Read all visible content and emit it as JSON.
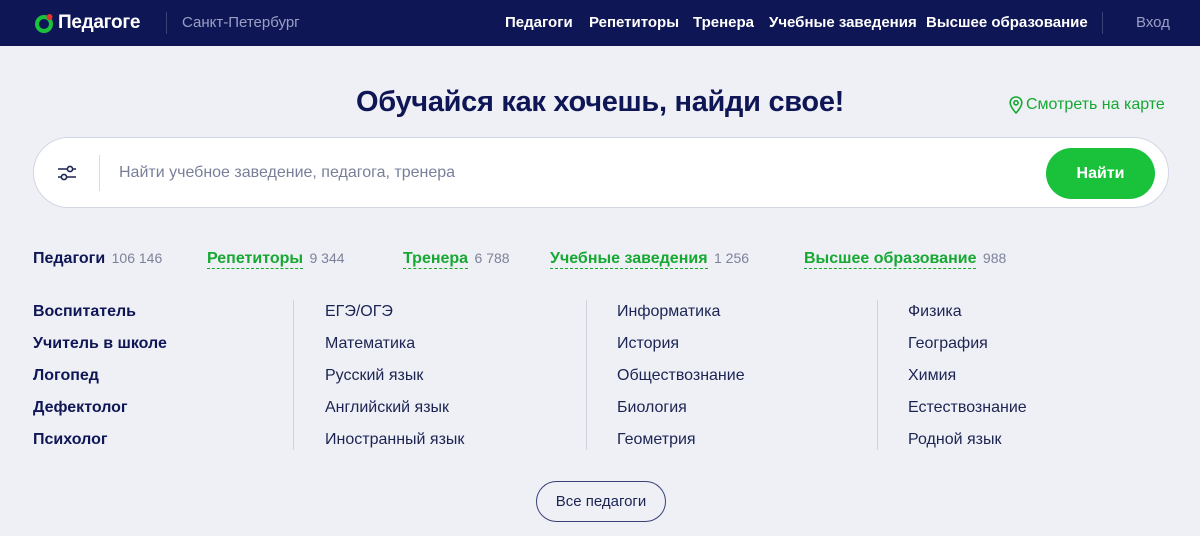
{
  "header": {
    "brand": "Педагоге",
    "city": "Санкт-Петербург",
    "nav": [
      "Педагоги",
      "Репетиторы",
      "Тренера",
      "Учебные заведения",
      "Высшее образование"
    ],
    "login": "Вход"
  },
  "hero": {
    "headline": "Обучайся как хочешь, найди свое!",
    "map_link": "Смотреть на карте"
  },
  "search": {
    "placeholder": "Найти учебное заведение, педагога, тренера",
    "button": "Найти"
  },
  "tabs": [
    {
      "label": "Педагоги",
      "count": "106 146"
    },
    {
      "label": "Репетиторы",
      "count": "9 344"
    },
    {
      "label": "Тренера",
      "count": "6 788"
    },
    {
      "label": "Учебные заведения",
      "count": "1 256"
    },
    {
      "label": "Высшее образование",
      "count": "988"
    }
  ],
  "categories": [
    [
      "Воспитатель",
      "Учитель в школе",
      "Логопед",
      "Дефектолог",
      "Психолог"
    ],
    [
      "ЕГЭ/ОГЭ",
      "Математика",
      "Русский язык",
      "Английский язык",
      "Иностранный язык"
    ],
    [
      "Информатика",
      "История",
      "Обществознание",
      "Биология",
      "Геометрия"
    ],
    [
      "Физика",
      "География",
      "Химия",
      "Естествознание",
      "Родной язык"
    ]
  ],
  "all_button": "Все педагоги",
  "colors": {
    "header_bg": "#0f1655",
    "accent_green": "#1ac23c",
    "page_bg": "#eef0f6"
  }
}
